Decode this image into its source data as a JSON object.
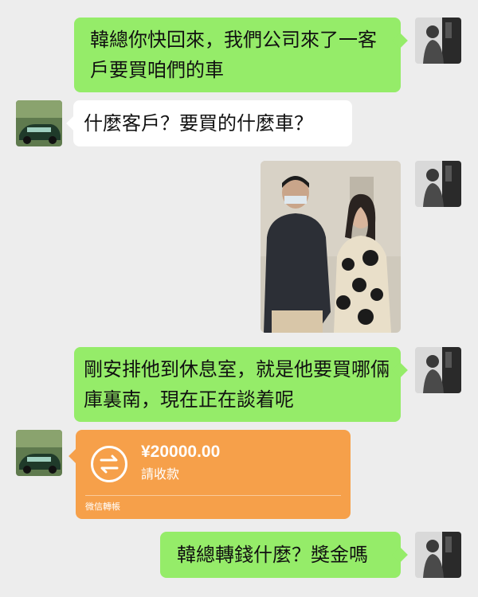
{
  "messages": [
    {
      "side": "right",
      "type": "text",
      "text": "韓總你快回來，我們公司來了一客戶要買咱們的車"
    },
    {
      "side": "left",
      "type": "text",
      "text": "什麼客戶？要買的什麼車？"
    },
    {
      "side": "right",
      "type": "image",
      "text": ""
    },
    {
      "side": "right",
      "type": "text",
      "text": "剛安排他到休息室，就是他要買哪倆庫裏南，現在正在談着呢"
    },
    {
      "side": "left",
      "type": "transfer"
    },
    {
      "side": "right",
      "type": "text",
      "text": "韓總轉錢什麼？獎金嗎"
    }
  ],
  "transfer": {
    "amount": "¥20000.00",
    "status": "請收款",
    "footer": "微信轉帳",
    "icon": "transfer-arrows-icon"
  },
  "colors": {
    "background": "#ededed",
    "sent_bubble": "#95ec69",
    "received_bubble": "#ffffff",
    "transfer_card": "#f6a04a"
  }
}
